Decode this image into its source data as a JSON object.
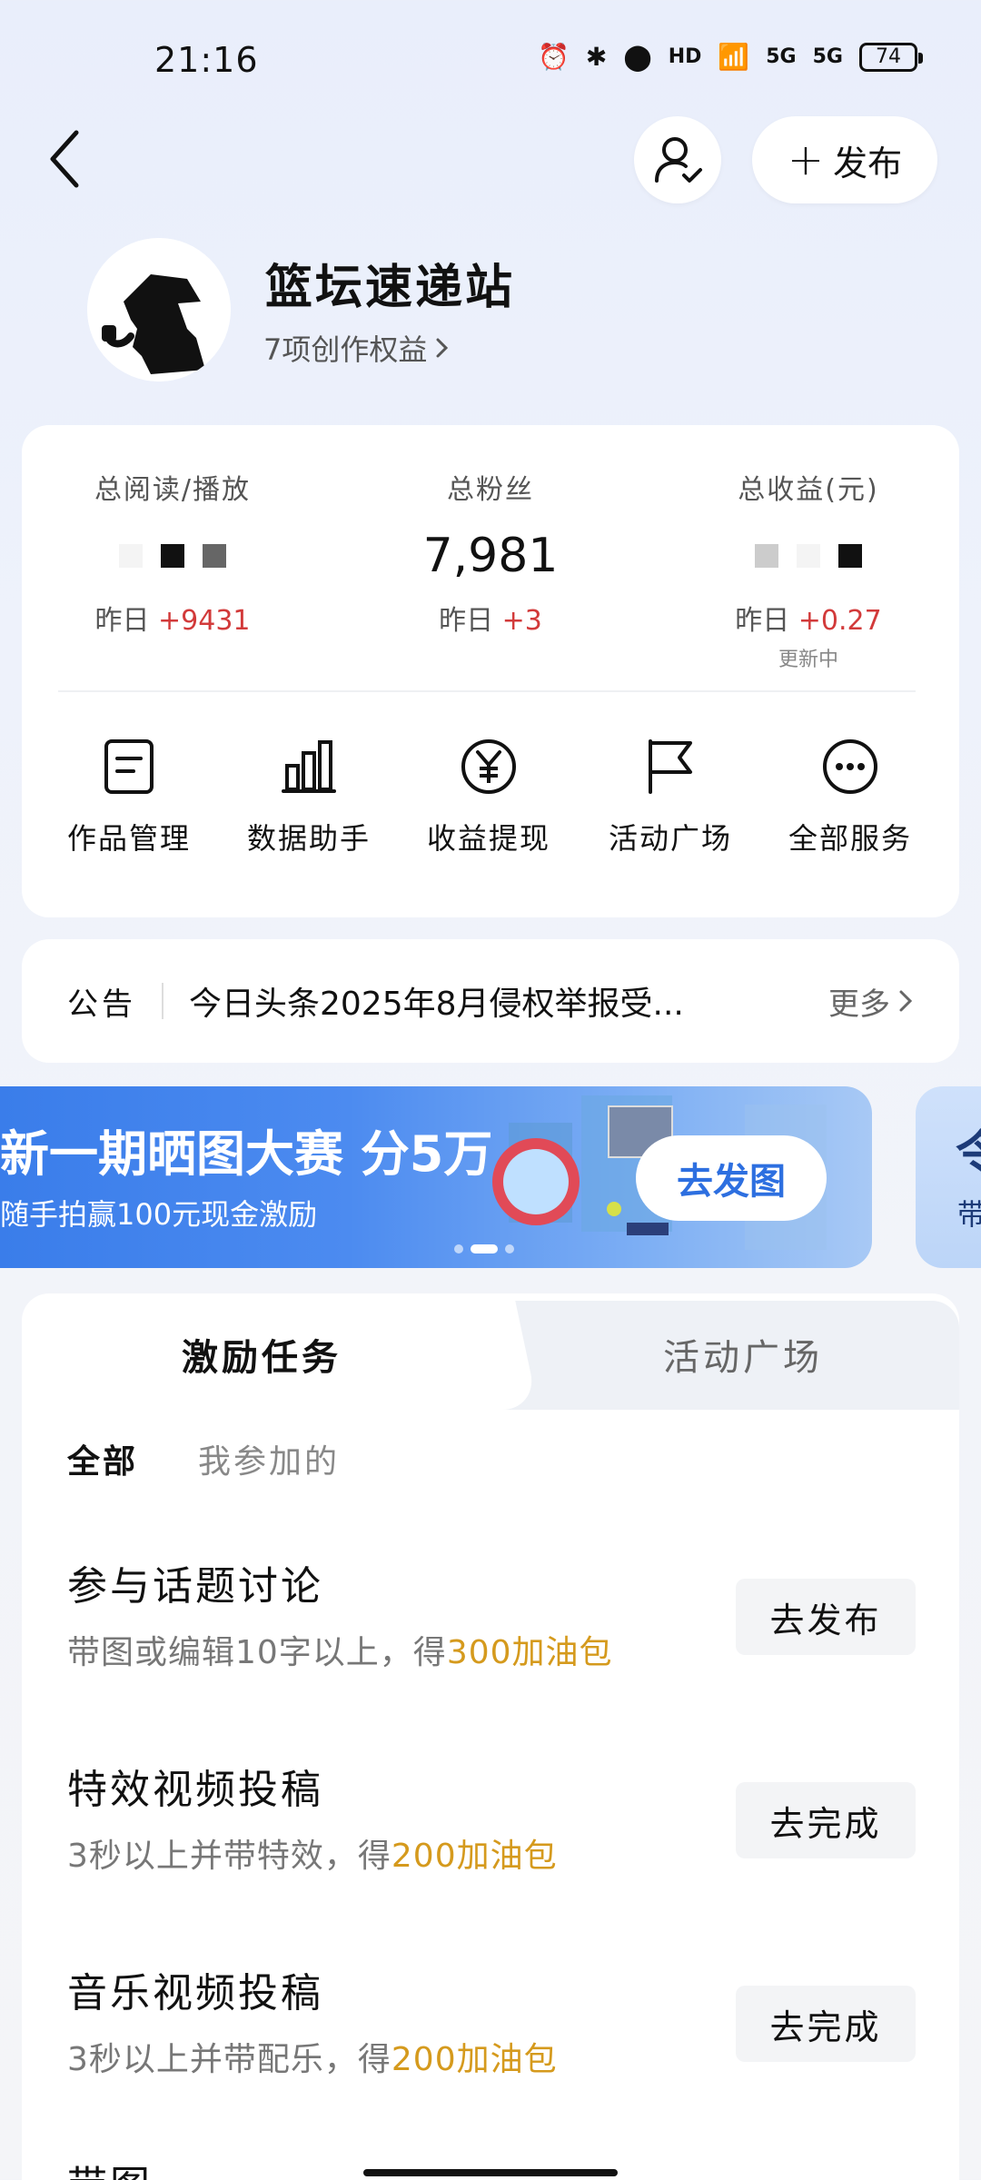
{
  "status_bar": {
    "time": "21:16",
    "battery": "74",
    "net1": "5G",
    "net2": "5G",
    "hd": "HD"
  },
  "header": {
    "publish_label": "发布"
  },
  "profile": {
    "name": "篮坛速递站",
    "rights": "7项创作权益"
  },
  "stats": [
    {
      "label": "总阅读/播放",
      "yesterday_prefix": "昨日",
      "yesterday_value": "+9431"
    },
    {
      "label": "总粉丝",
      "value": "7,981",
      "yesterday_prefix": "昨日",
      "yesterday_value": "+3"
    },
    {
      "label": "总收益(元)",
      "yesterday_prefix": "昨日",
      "yesterday_value": "+0.27",
      "sub": "更新中"
    }
  ],
  "services": [
    {
      "label": "作品管理",
      "icon": "document-icon"
    },
    {
      "label": "数据助手",
      "icon": "bar-chart-icon"
    },
    {
      "label": "收益提现",
      "icon": "yen-icon"
    },
    {
      "label": "活动广场",
      "icon": "flag-icon"
    },
    {
      "label": "全部服务",
      "icon": "more-icon"
    }
  ],
  "notice": {
    "tag": "公告",
    "text": "今日头条2025年8月侵权举报受...",
    "more": "更多"
  },
  "banner": {
    "title": "新一期晒图大赛 分5万",
    "subtitle": "随手拍赢100元现金激励",
    "button": "去发图"
  },
  "banner_next": {
    "title": "令",
    "subtitle": "带"
  },
  "tabs": {
    "active": "激励任务",
    "inactive": "活动广场"
  },
  "filters": {
    "all": "全部",
    "joined": "我参加的"
  },
  "tasks": [
    {
      "title": "参与话题讨论",
      "desc": "带图或编辑10字以上，得",
      "reward": "300加油包",
      "button": "去发布"
    },
    {
      "title": "特效视频投稿",
      "desc": "3秒以上并带特效，得",
      "reward": "200加油包",
      "button": "去完成"
    },
    {
      "title": "音乐视频投稿",
      "desc": "3秒以上并带配乐，得",
      "reward": "200加油包",
      "button": "去完成"
    }
  ],
  "partial_task_title": "带图"
}
